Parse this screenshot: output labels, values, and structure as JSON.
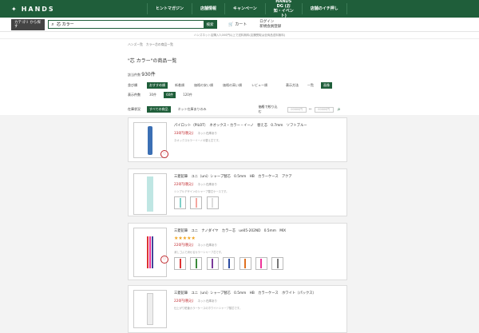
{
  "header": {
    "logo": "HANDS",
    "nav": [
      "ヒントマガジン",
      "店舗情報",
      "キャンペーン",
      "HANDS DG (お知・イベント)",
      "店舗のイチ押し"
    ]
  },
  "subbar": {
    "category_label": "カテゴリ から探す",
    "search_value": "芯 カラー",
    "search_button": "検索",
    "cart_label": "カート",
    "login_label": "ログイン",
    "register_label": "新規会員登録"
  },
  "notice": "ハンズネット店購入3,000円以上で送料無料(店舗受取は全商品送料無料)",
  "breadcrumb": "ハンズ一覧　カラー芯の商品一覧",
  "page": {
    "title": "\"芯 カラー\"の商品一覧",
    "count_prefix": "該当件数",
    "count_value": "930件"
  },
  "filters": {
    "sort_label": "並び順",
    "sort_options": [
      "おすすめ順",
      "新着順",
      "価格の安い順",
      "価格の高い順",
      "レビュー順"
    ],
    "display_label": "表示方法",
    "display_options": [
      "一覧",
      "画像"
    ],
    "count_label": "表示件数",
    "count_options": [
      "30件",
      "60件",
      "120件"
    ],
    "stock_label": "在庫状況",
    "stock_options": [
      "すべての商品",
      "ネット在庫ありのみ"
    ],
    "price_label": "価格で絞り込む",
    "price_min_placeholder": "00000円",
    "price_max_placeholder": "00000円"
  },
  "products": [
    {
      "name": "パイロット（PILOT）　ネオックス・カラー・イーノ　替え芯　0.7mm　ソフトブルー",
      "price": "330円(税込)",
      "stock": "ネット在庫あり",
      "desc": "ネオックスカラーイーノの替え芯です。"
    },
    {
      "name": "三菱鉛筆　ユニ（uni）シャープ替芯　0.5mm　HB　カラーケース　アクア",
      "price": "220円(税込)",
      "stock": "ネット在庫あり",
      "desc": "シンプルデザインのシャープ替芯ケースです。"
    },
    {
      "name": "三菱鉛筆　ユニ　ナノダイヤ　カラー芯　ue05-202ND　0.5mm　MIX",
      "rating": "★★★★★",
      "price": "220円(税込)",
      "stock": "ネット在庫あり",
      "desc": "消しゴムで消せるカラーシャープ芯です。"
    },
    {
      "name": "三菱鉛筆　ユニ（uni）シャープ替芯　0.5mm　HB　カラーケース　ホワイト（パックス）",
      "price": "220円(税込)",
      "stock": "ネット在庫あり",
      "desc": "仕上がり鉛筆カラーケースのホワイトシャープ替芯です。"
    }
  ],
  "colors": {
    "brand": "#1f5e3a",
    "price": "#c0282d"
  }
}
